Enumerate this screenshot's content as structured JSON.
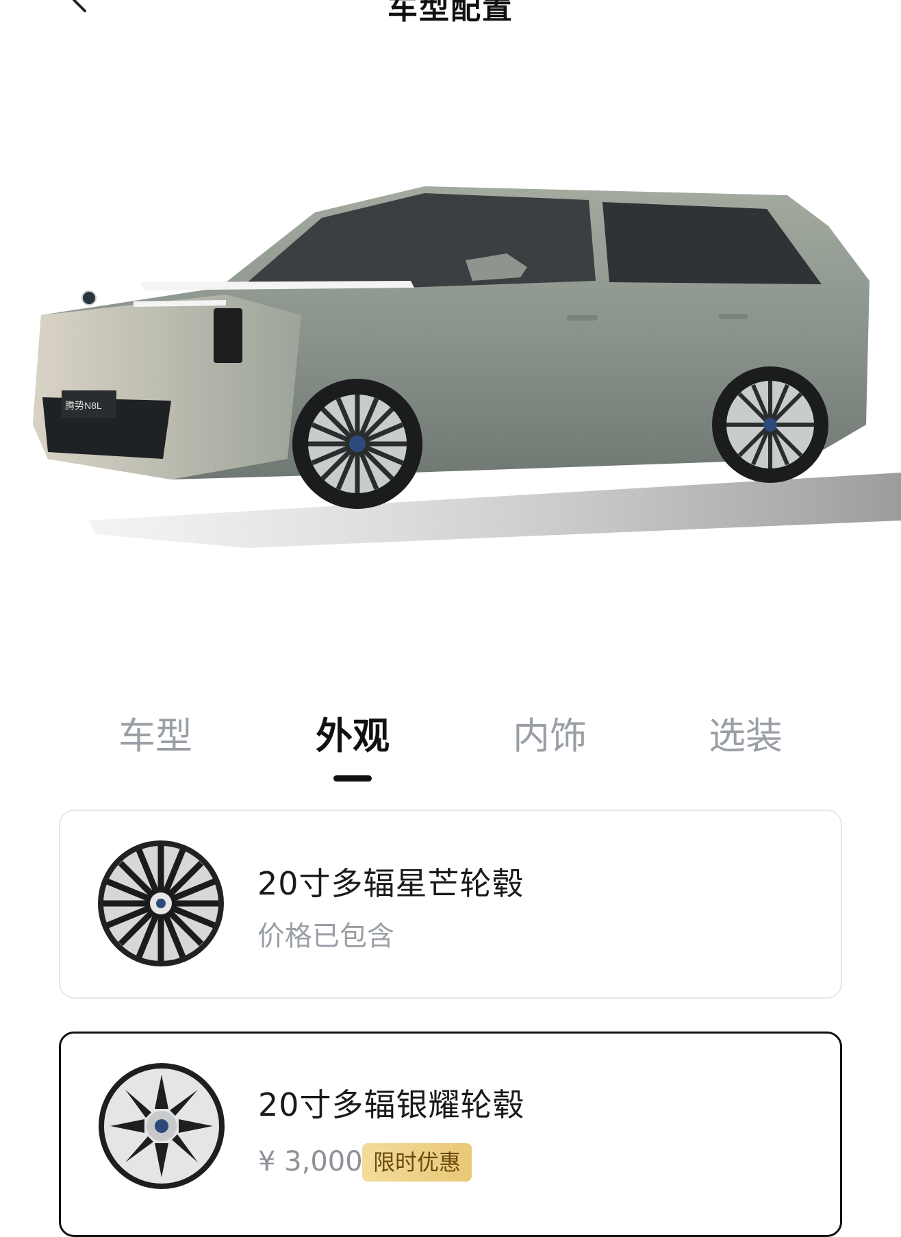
{
  "header": {
    "title": "车型配置",
    "back_icon": "chevron-left-icon"
  },
  "hero": {
    "image": "car-exterior-image",
    "badge_text": "腾势N8L",
    "car_color": "#8a938c"
  },
  "tabs": [
    {
      "label": "车型",
      "active": false
    },
    {
      "label": "外观",
      "active": true
    },
    {
      "label": "内饰",
      "active": false
    },
    {
      "label": "选装",
      "active": false
    }
  ],
  "options": [
    {
      "name": "20寸多辐星芒轮毂",
      "subtitle": "价格已包含",
      "selected": false
    },
    {
      "name": "20寸多辐银耀轮毂",
      "price": "¥ 3,000",
      "badge": "限时优惠",
      "selected": true
    }
  ],
  "colors": {
    "accent": "#111111",
    "muted": "#9a9fa6",
    "badge_bg": "#e9c877"
  }
}
